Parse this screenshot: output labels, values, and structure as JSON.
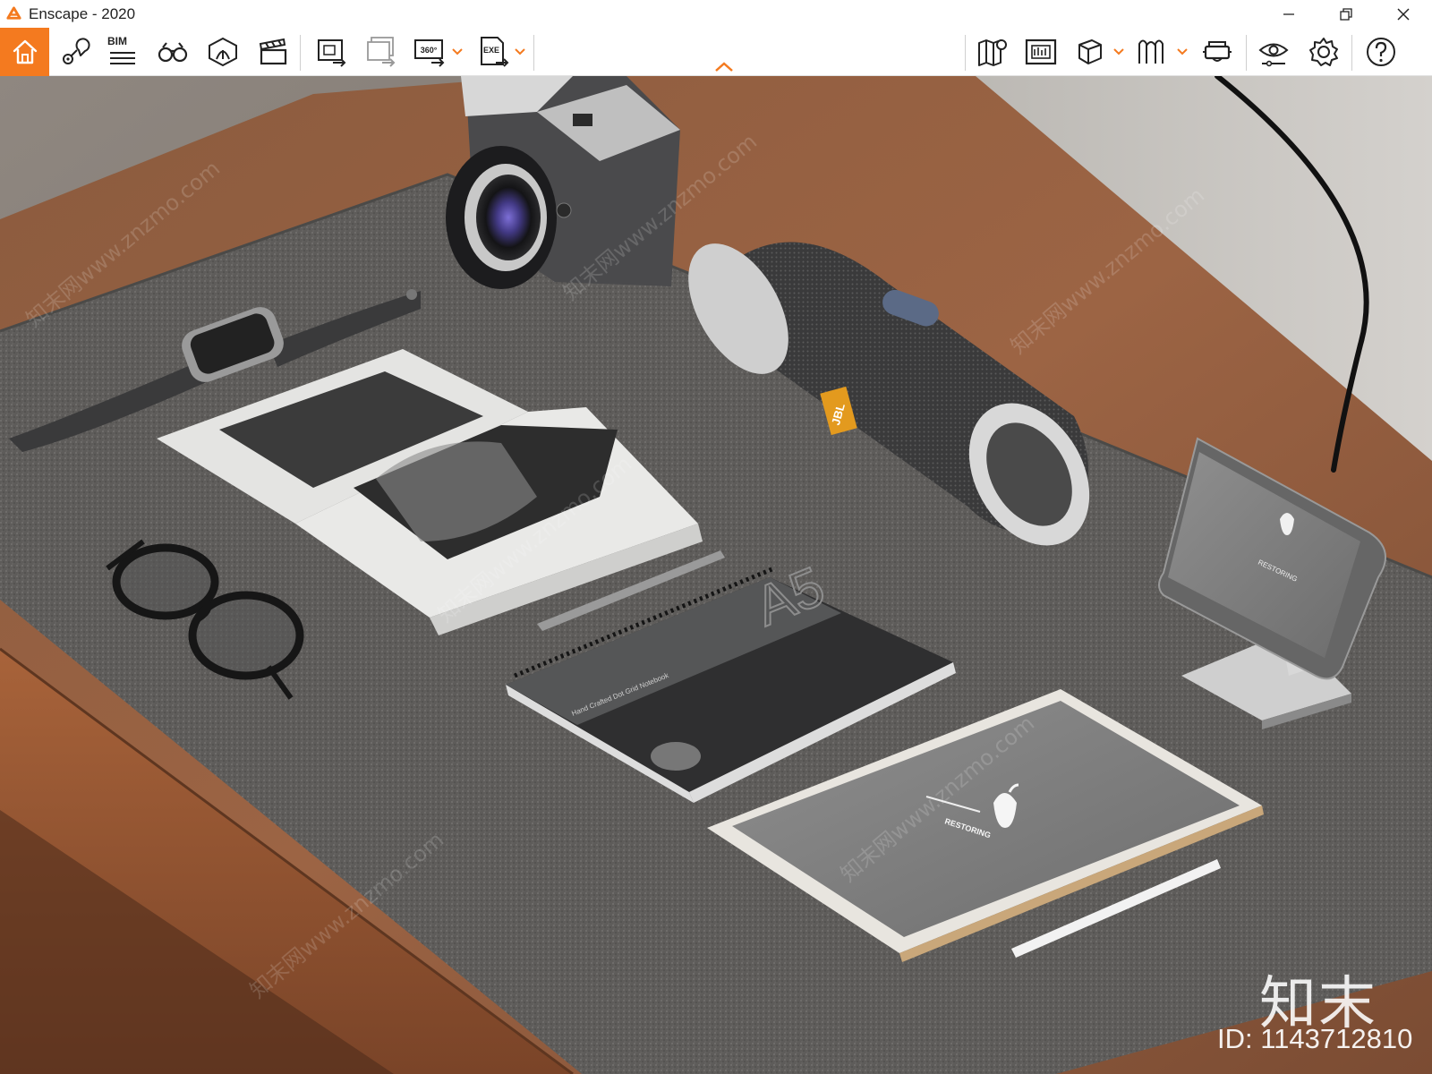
{
  "window": {
    "title": "Enscape - 2020",
    "minimize_icon": "minimize-icon",
    "maximize_icon": "restore-icon",
    "close_icon": "close-icon"
  },
  "toolbar": {
    "accent_color": "#f47a1f",
    "left_tools": [
      {
        "name": "home",
        "icon": "home-icon"
      },
      {
        "name": "views",
        "icon": "location-pin-icon"
      },
      {
        "name": "bim",
        "icon": "bim-list-icon",
        "label": "BIM"
      },
      {
        "name": "walk-mode",
        "icon": "binoculars-icon"
      },
      {
        "name": "atmosphere",
        "icon": "atmosphere-icon"
      },
      {
        "name": "video-editor",
        "icon": "clapperboard-icon"
      },
      {
        "name": "render-image",
        "icon": "render-image-icon"
      },
      {
        "name": "batch-render",
        "icon": "batch-render-icon"
      },
      {
        "name": "render-panorama",
        "icon": "panorama-360-icon",
        "label": "360°"
      },
      {
        "name": "export",
        "icon": "export-exe-icon",
        "label": "EXE"
      }
    ],
    "right_tools": [
      {
        "name": "map",
        "icon": "map-icon"
      },
      {
        "name": "material-editor",
        "icon": "material-icon"
      },
      {
        "name": "asset-library",
        "icon": "cube-icon"
      },
      {
        "name": "collaboration",
        "icon": "people-icon"
      },
      {
        "name": "vr-headset",
        "icon": "vr-headset-icon"
      },
      {
        "name": "visual-settings",
        "icon": "eye-settings-icon"
      },
      {
        "name": "general-settings",
        "icon": "gear-icon"
      },
      {
        "name": "help",
        "icon": "help-icon"
      }
    ]
  },
  "viewport": {
    "scene_objects": [
      "camera",
      "smartwatch",
      "photo-book",
      "bluetooth-speaker",
      "smartphone-on-stand",
      "glasses",
      "pen",
      "notebook",
      "tablet",
      "stylus",
      "desk-lamp",
      "desk",
      "felt-mat"
    ],
    "speaker_brand": "JBL",
    "notebook_size": "A5",
    "notebook_cover_text": "Hand Crafted Dot Grid Notebook",
    "tablet_screen_text": "RESTORING",
    "phone_screen_text": "RESTORING",
    "watermark_text": "知末网www.znzmo.com",
    "brand_mark": "知末",
    "image_id": "ID: 1143712810"
  }
}
